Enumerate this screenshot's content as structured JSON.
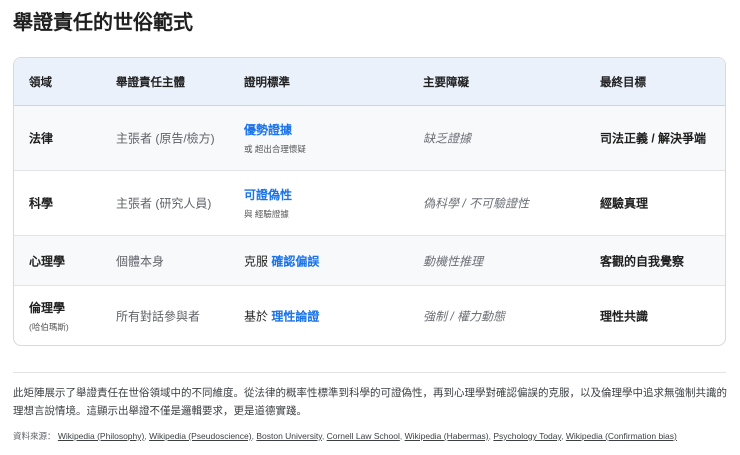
{
  "title": "舉證責任的世俗範式",
  "headers": [
    "領域",
    "舉證責任主體",
    "證明標準",
    "主要障礙",
    "最終目標"
  ],
  "rows": [
    {
      "field": "法律",
      "field_sub": "",
      "who": "主張者 (原告/檢方)",
      "std_prefix": "",
      "std": "優勢證據",
      "std_sub": "或 超出合理懷疑",
      "obstacle": "缺乏證據",
      "goal": "司法正義 / 解決爭端"
    },
    {
      "field": "科學",
      "field_sub": "",
      "who": "主張者 (研究人員)",
      "std_prefix": "",
      "std": "可證偽性",
      "std_sub": "與 經驗證據",
      "obstacle": "偽科學 / 不可驗證性",
      "goal": "經驗真理"
    },
    {
      "field": "心理學",
      "field_sub": "",
      "who": "個體本身",
      "std_prefix": "克服 ",
      "std": "確認偏誤",
      "std_sub": "",
      "obstacle": "動機性推理",
      "goal": "客觀的自我覺察"
    },
    {
      "field": "倫理學",
      "field_sub": "(哈伯瑪斯)",
      "who": "所有對話參與者",
      "std_prefix": "基於 ",
      "std": "理性論證",
      "std_sub": "",
      "obstacle": "強制 / 權力動態",
      "goal": "理性共識"
    }
  ],
  "paragraph": "此矩陣展示了舉證責任在世俗領域中的不同維度。從法律的概率性標準到科學的可證偽性，再到心理學對確認偏誤的克服，以及倫理學中追求無強制共識的理想言說情境。這顯示出舉證不僅是邏輯要求，更是道德實踐。",
  "sources_label": "資料來源：",
  "sources": [
    "Wikipedia (Philosophy)",
    "Wikipedia (Pseudoscience)",
    "Boston University",
    "Cornell Law School",
    "Wikipedia (Habermas)",
    "Psychology Today",
    "Wikipedia (Confirmation bias)"
  ]
}
